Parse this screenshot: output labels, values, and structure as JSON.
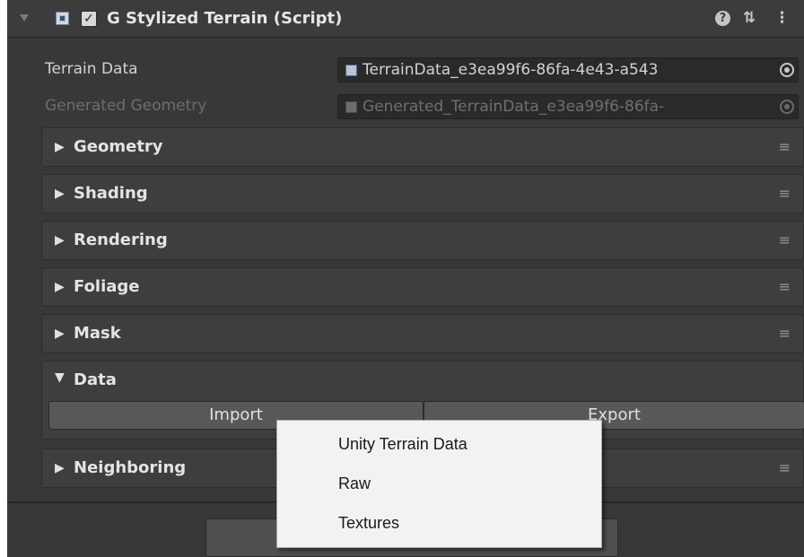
{
  "component": {
    "title": "G Stylized Terrain (Script)",
    "enabled": true,
    "enabled_mark": "✓",
    "icons": [
      "script-icon",
      "help-icon",
      "preset-icon",
      "kebab-menu-icon"
    ],
    "help_glyph": "?",
    "preset_glyph": "⇅",
    "kebab_glyph": "⋮"
  },
  "properties": {
    "terrain_data": {
      "label": "Terrain Data",
      "value": "TerrainData_e3ea99f6-86fa-4e43-a543"
    },
    "generated_geometry": {
      "label": "Generated Geometry",
      "value": "Generated_TerrainData_e3ea99f6-86fa-"
    }
  },
  "sections": [
    {
      "title": "Geometry",
      "expanded": false,
      "arrow": "▶"
    },
    {
      "title": "Shading",
      "expanded": false,
      "arrow": "▶"
    },
    {
      "title": "Rendering",
      "expanded": false,
      "arrow": "▶"
    },
    {
      "title": "Foliage",
      "expanded": false,
      "arrow": "▶"
    },
    {
      "title": "Mask",
      "expanded": false,
      "arrow": "▶"
    },
    {
      "title": "Data",
      "expanded": true,
      "arrow": "▼"
    },
    {
      "title": "Neighboring",
      "expanded": false,
      "arrow": "▶"
    }
  ],
  "section_menu_glyph": "≡",
  "data_buttons": {
    "import": "Import",
    "export": "Export"
  },
  "context_menu": {
    "items": [
      "Unity Terrain Data",
      "Raw",
      "Textures"
    ]
  },
  "colors": {
    "panel_bg": "#383838",
    "section_bg": "#3e3e3e",
    "menu_bg": "#f2f2f2"
  }
}
